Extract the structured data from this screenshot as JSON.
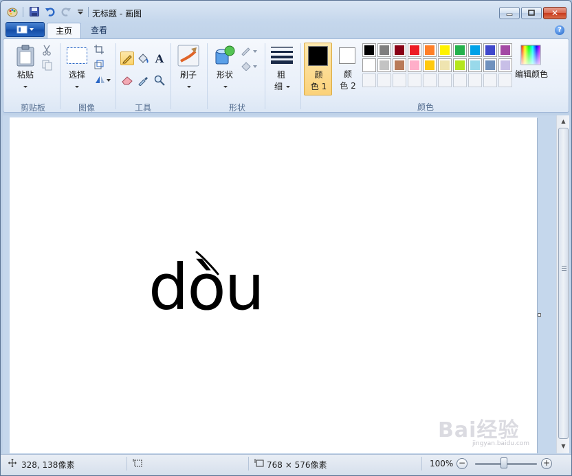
{
  "window": {
    "title": "无标题 - 画图",
    "close_glyph": "✕"
  },
  "tabs": [
    {
      "label": "主页",
      "active": true
    },
    {
      "label": "查看",
      "active": false
    }
  ],
  "ribbon": {
    "groups": {
      "clipboard": "剪贴板",
      "image": "图像",
      "tools": "工具",
      "shapes": "形状",
      "colors": "颜色"
    },
    "paste_label": "粘贴",
    "select_label": "选择",
    "brushes_label": "刷子",
    "shapes_label": "形状",
    "size_label_top": "粗",
    "size_label_bottom": "细",
    "color1_top": "颜",
    "color1_bottom": "色 1",
    "color2_top": "颜",
    "color2_bottom": "色 2",
    "edit_colors_label": "编辑颜色",
    "text_tool_glyph": "A",
    "color1_value": "#000000",
    "color2_value": "#ffffff",
    "palette_row1": [
      "#000000",
      "#7f7f7f",
      "#880015",
      "#ed1c24",
      "#ff7f27",
      "#fff200",
      "#22b14c",
      "#00a2e8",
      "#3f48cc",
      "#a349a4"
    ],
    "palette_row2": [
      "#ffffff",
      "#c3c3c3",
      "#b97a57",
      "#ffaec9",
      "#ffc90e",
      "#efe4b0",
      "#b5e61d",
      "#99d9ea",
      "#7092be",
      "#c8bfe7"
    ]
  },
  "canvas": {
    "text": "dòu"
  },
  "statusbar": {
    "cursor_pos": "328, 138像素",
    "canvas_size": "768 × 576像素",
    "zoom": "100%",
    "zoom_out": "−",
    "zoom_in": "+"
  },
  "watermark": {
    "text": "Bai经验",
    "url": "jingyan.baidu.com"
  }
}
